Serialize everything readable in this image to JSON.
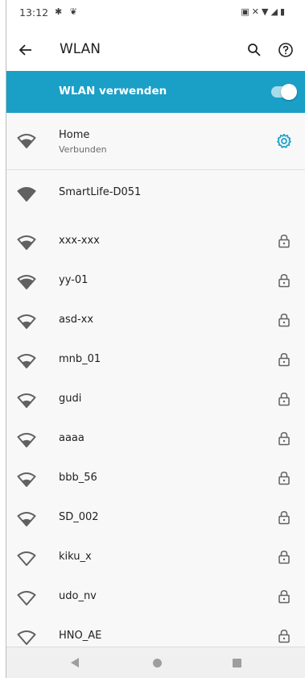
{
  "status_bar": {
    "time": "13:12",
    "left_icons": [
      "settings-icon",
      "cat-icon"
    ],
    "right_icons": [
      "nfc-icon",
      "mute-icon",
      "wifi-icon",
      "signal-icon",
      "battery-icon"
    ]
  },
  "toolbar": {
    "title": "WLAN",
    "back_icon": "arrow-back-icon",
    "search_icon": "search-icon",
    "help_icon": "help-icon"
  },
  "master_switch": {
    "label": "WLAN verwenden",
    "on": true,
    "bar_color": "#1a9fc7"
  },
  "connected_network": {
    "name": "Home",
    "status": "Verbunden",
    "settings_icon": "gear-icon",
    "accent_color": "#1a9fc7"
  },
  "networks": [
    {
      "name": "SmartLife-D051",
      "locked": false
    },
    {
      "name": "xxx-xxx",
      "locked": true
    },
    {
      "name": "yy-01",
      "locked": true
    },
    {
      "name": "asd-xx",
      "locked": true
    },
    {
      "name": "mnb_01",
      "locked": true
    },
    {
      "name": "gudi",
      "locked": true
    },
    {
      "name": "aaaa",
      "locked": true
    },
    {
      "name": "bbb_56",
      "locked": true
    },
    {
      "name": "SD_002",
      "locked": true
    },
    {
      "name": "kiku_x",
      "locked": true
    },
    {
      "name": "udo_nv",
      "locked": true
    },
    {
      "name": "HNO_AE",
      "locked": true
    }
  ],
  "nav_bar": {
    "buttons": [
      "back-triangle-icon",
      "home-circle-icon",
      "recents-square-icon"
    ]
  }
}
